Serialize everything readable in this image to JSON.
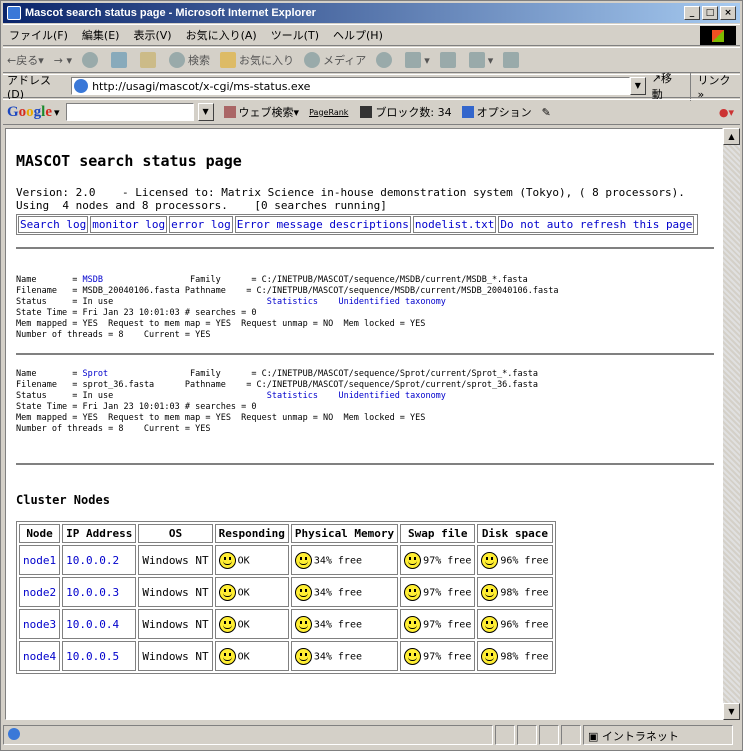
{
  "window": {
    "title": "Mascot search status page - Microsoft Internet Explorer"
  },
  "menu": [
    "ファイル(F)",
    "編集(E)",
    "表示(V)",
    "お気に入り(A)",
    "ツール(T)",
    "ヘルプ(H)"
  ],
  "toolbar": {
    "back": "戻る",
    "search": "検索",
    "favorites": "お気に入り",
    "media": "メディア"
  },
  "address": {
    "label": "アドレス(D)",
    "url": "http://usagi/mascot/x-cgi/ms-status.exe",
    "go": "移動",
    "links": "リンク »"
  },
  "google": {
    "search_btn": "ウェブ検索",
    "pagerank": "PageRank",
    "block_count": "ブロック数: 34",
    "options": "オプション"
  },
  "page": {
    "title": "MASCOT search status page",
    "intro_line1": "Version: 2.0    - Licensed to: Matrix Science in-house demonstration system (Tokyo), ( 8 processors).",
    "intro_line2": "Using  4 nodes and 8 processors.    [0 searches running]",
    "links": [
      "Search log",
      "monitor log",
      "error log",
      "Error message descriptions",
      "nodelist.txt",
      "Do not auto refresh this page"
    ],
    "db1": {
      "name": "MSDB",
      "family": "C:/INETPUB/MASCOT/sequence/MSDB/current/MSDB_*.fasta",
      "filename": "MSDB_20040106.fasta",
      "pathname": "C:/INETPUB/MASCOT/sequence/MSDB/current/MSDB_20040106.fasta",
      "status": "In use",
      "statistics": "Statistics",
      "taxonomy": "Unidentified taxonomy",
      "state_time": "State Time = Fri Jan 23 10:01:03 # searches = 0",
      "mem": "Mem mapped = YES  Request to mem map = YES  Request unmap = NO  Mem locked = YES",
      "threads": "Number of threads = 8    Current = YES"
    },
    "db2": {
      "name": "Sprot",
      "family": "C:/INETPUB/MASCOT/sequence/Sprot/current/Sprot_*.fasta",
      "filename": "sprot_36.fasta",
      "pathname": "C:/INETPUB/MASCOT/sequence/Sprot/current/sprot_36.fasta",
      "status": "In use",
      "statistics": "Statistics",
      "taxonomy": "Unidentified taxonomy",
      "state_time": "State Time = Fri Jan 23 10:01:03 # searches = 0",
      "mem": "Mem mapped = YES  Request to mem map = YES  Request unmap = NO  Mem locked = YES",
      "threads": "Number of threads = 8    Current = YES"
    },
    "cluster_title": "Cluster Nodes",
    "cluster_headers": [
      "Node",
      "IP Address",
      "OS",
      "Responding",
      "Physical Memory",
      "Swap file",
      "Disk space"
    ],
    "nodes": [
      {
        "node": "node1",
        "ip": "10.0.0.2",
        "os": "Windows NT",
        "resp": "OK",
        "mem": "34% free",
        "swap": "97% free",
        "disk": "96% free"
      },
      {
        "node": "node2",
        "ip": "10.0.0.3",
        "os": "Windows NT",
        "resp": "OK",
        "mem": "34% free",
        "swap": "97% free",
        "disk": "98% free"
      },
      {
        "node": "node3",
        "ip": "10.0.0.4",
        "os": "Windows NT",
        "resp": "OK",
        "mem": "34% free",
        "swap": "97% free",
        "disk": "96% free"
      },
      {
        "node": "node4",
        "ip": "10.0.0.5",
        "os": "Windows NT",
        "resp": "OK",
        "mem": "34% free",
        "swap": "97% free",
        "disk": "98% free"
      }
    ]
  },
  "status": {
    "zone": "イントラネット"
  }
}
